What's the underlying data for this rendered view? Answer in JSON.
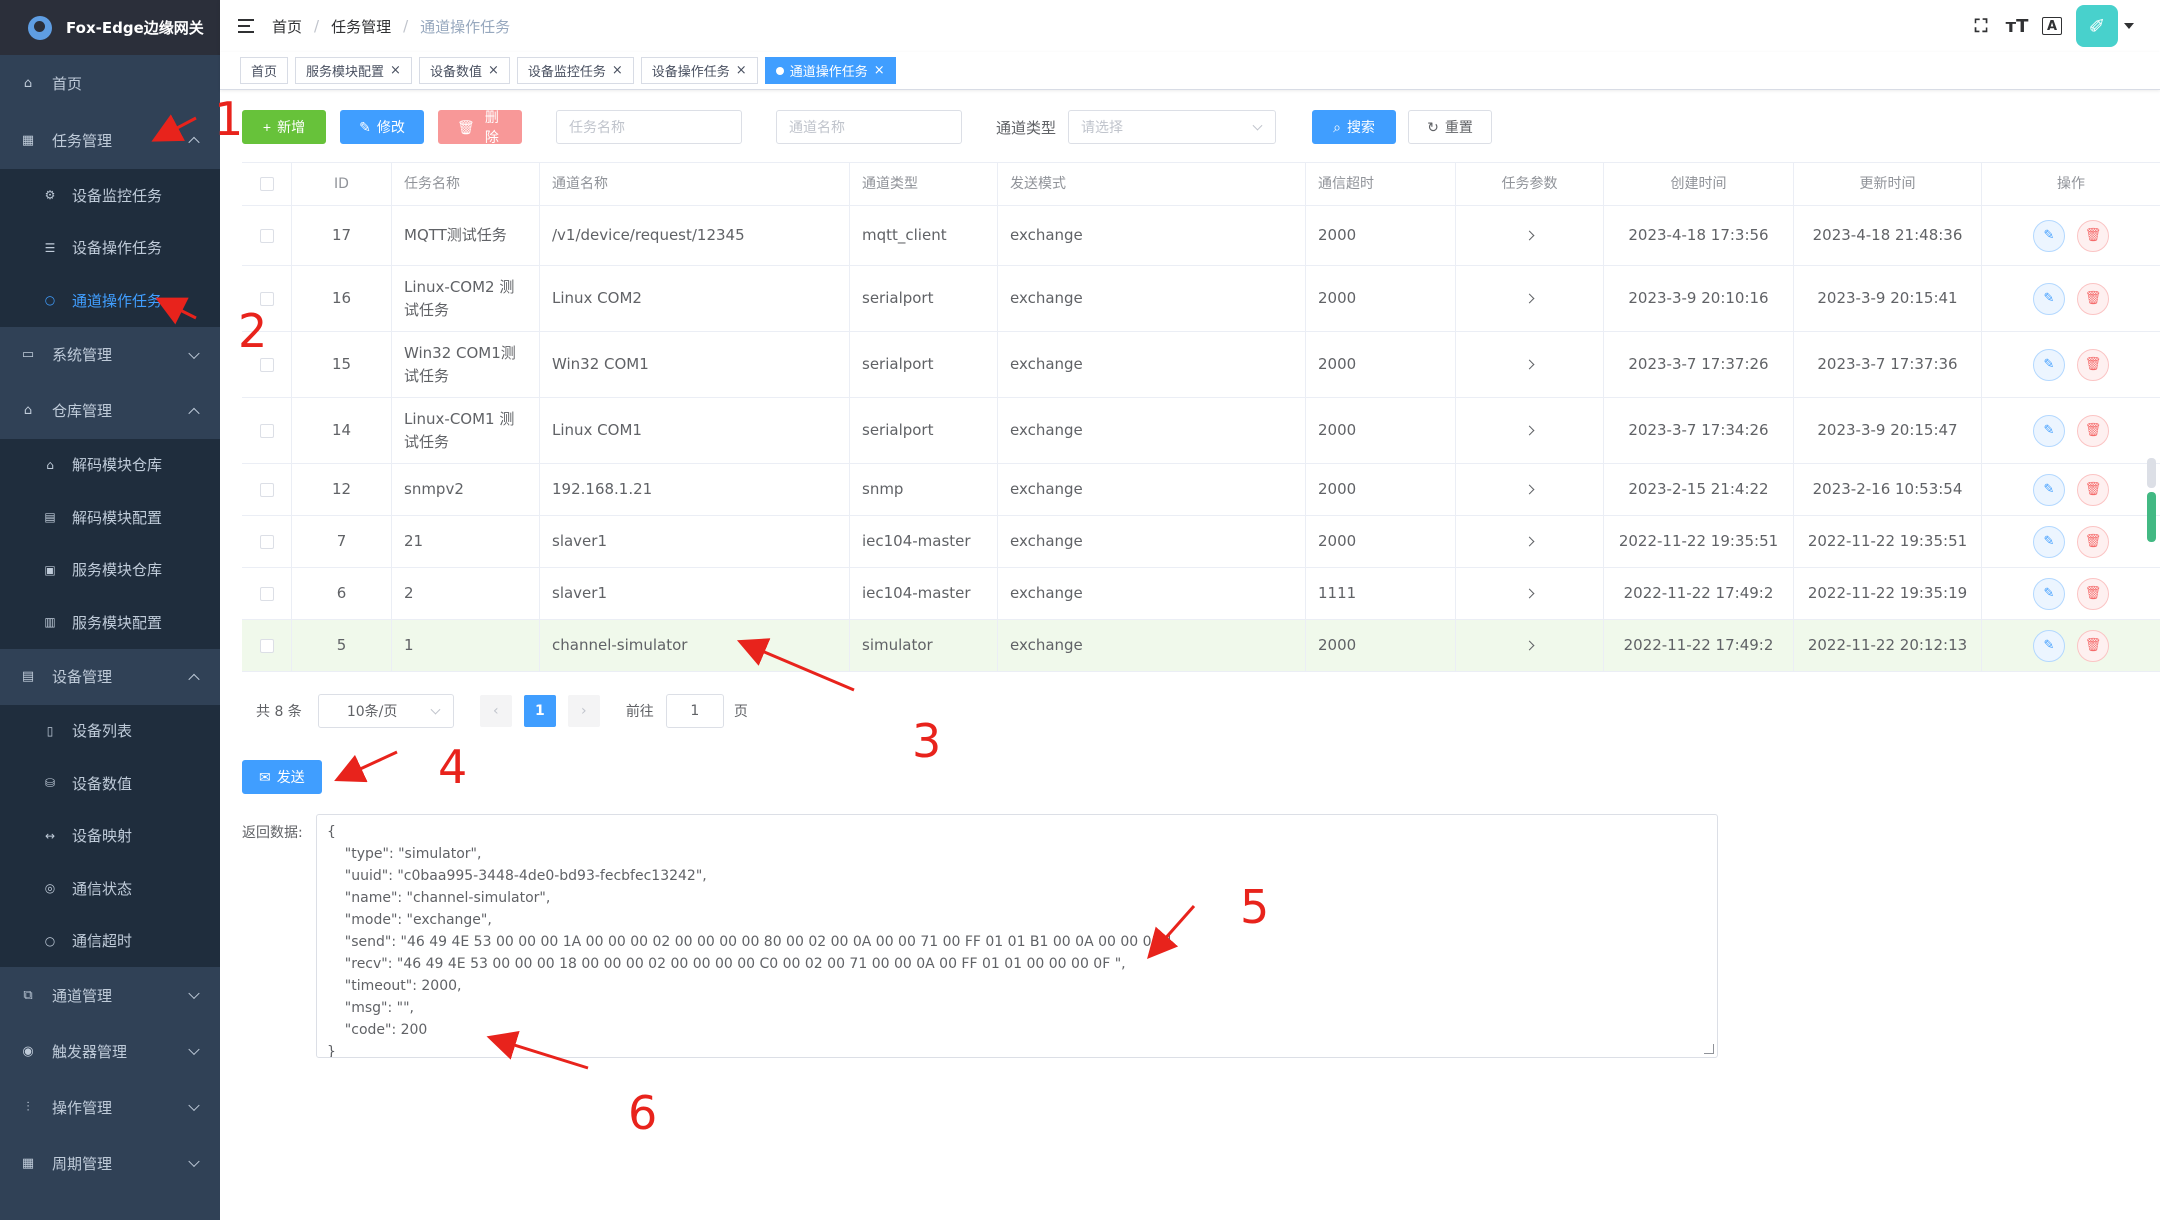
{
  "app": {
    "title": "Fox-Edge边缘网关"
  },
  "sidebar": {
    "home": "首页",
    "task_mgmt": "任务管理",
    "task_children": [
      "设备监控任务",
      "设备操作任务",
      "通道操作任务"
    ],
    "system_mgmt": "系统管理",
    "warehouse_mgmt": "仓库管理",
    "warehouse_children": [
      "解码模块仓库",
      "解码模块配置",
      "服务模块仓库",
      "服务模块配置"
    ],
    "device_mgmt": "设备管理",
    "device_children": [
      "设备列表",
      "设备数值",
      "设备映射",
      "通信状态",
      "通信超时"
    ],
    "channel_mgmt": "通道管理",
    "trigger_mgmt": "触发器管理",
    "operation_mgmt": "操作管理",
    "period_mgmt": "周期管理"
  },
  "breadcrumb": [
    "首页",
    "任务管理",
    "通道操作任务"
  ],
  "tags": [
    "首页",
    "服务模块配置",
    "设备数值",
    "设备监控任务",
    "设备操作任务",
    "通道操作任务"
  ],
  "toolbar": {
    "add": "新增",
    "edit": "修改",
    "delete": "删除",
    "task_name_placeholder": "任务名称",
    "channel_name_placeholder": "通道名称",
    "channel_type_label": "通道类型",
    "channel_type_placeholder": "请选择",
    "search": "搜索",
    "reset": "重置"
  },
  "table": {
    "headers": [
      "ID",
      "任务名称",
      "通道名称",
      "通道类型",
      "发送模式",
      "通信超时",
      "任务参数",
      "创建时间",
      "更新时间",
      "操作"
    ],
    "rows": [
      {
        "id": "17",
        "task": "MQTT测试任务",
        "channel": "/v1/device/request/12345",
        "type": "mqtt_client",
        "mode": "exchange",
        "timeout": "2000",
        "created": "2023-4-18 17:3:56",
        "updated": "2023-4-18 21:48:36"
      },
      {
        "id": "16",
        "task": "Linux-COM2 测试任务",
        "channel": "Linux COM2",
        "type": "serialport",
        "mode": "exchange",
        "timeout": "2000",
        "created": "2023-3-9 20:10:16",
        "updated": "2023-3-9 20:15:41"
      },
      {
        "id": "15",
        "task": "Win32 COM1测试任务",
        "channel": "Win32 COM1",
        "type": "serialport",
        "mode": "exchange",
        "timeout": "2000",
        "created": "2023-3-7 17:37:26",
        "updated": "2023-3-7 17:37:36"
      },
      {
        "id": "14",
        "task": "Linux-COM1 测试任务",
        "channel": "Linux COM1",
        "type": "serialport",
        "mode": "exchange",
        "timeout": "2000",
        "created": "2023-3-7 17:34:26",
        "updated": "2023-3-9 20:15:47"
      },
      {
        "id": "12",
        "task": "snmpv2",
        "channel": "192.168.1.21",
        "type": "snmp",
        "mode": "exchange",
        "timeout": "2000",
        "created": "2023-2-15 21:4:22",
        "updated": "2023-2-16 10:53:54"
      },
      {
        "id": "7",
        "task": "21",
        "channel": "slaver1",
        "type": "iec104-master",
        "mode": "exchange",
        "timeout": "2000",
        "created": "2022-11-22 19:35:51",
        "updated": "2022-11-22 19:35:51"
      },
      {
        "id": "6",
        "task": "2",
        "channel": "slaver1",
        "type": "iec104-master",
        "mode": "exchange",
        "timeout": "1111",
        "created": "2022-11-22 17:49:2",
        "updated": "2022-11-22 19:35:19"
      },
      {
        "id": "5",
        "task": "1",
        "channel": "channel-simulator",
        "type": "simulator",
        "mode": "exchange",
        "timeout": "2000",
        "created": "2022-11-22 17:49:2",
        "updated": "2022-11-22 20:12:13"
      }
    ]
  },
  "pagination": {
    "total": "共 8 条",
    "page_size": "10条/页",
    "current": "1",
    "goto_label": "前往",
    "goto_value": "1",
    "page_unit": "页"
  },
  "send_button": "发送",
  "return_label": "返回数据:",
  "return_data": "{\n    \"type\": \"simulator\",\n    \"uuid\": \"c0baa995-3448-4de0-bd93-fecbfec13242\",\n    \"name\": \"channel-simulator\",\n    \"mode\": \"exchange\",\n    \"send\": \"46 49 4E 53 00 00 00 1A 00 00 00 02 00 00 00 00 80 00 02 00 0A 00 00 71 00 FF 01 01 B1 00 0A 00 00 01 \",\n    \"recv\": \"46 49 4E 53 00 00 00 18 00 00 00 02 00 00 00 00 C0 00 02 00 71 00 00 0A 00 FF 01 01 00 00 00 0F \",\n    \"timeout\": 2000,\n    \"msg\": \"\",\n    \"code\": 200\n}",
  "annotations": [
    "1",
    "2",
    "3",
    "4",
    "5",
    "6"
  ],
  "colors": {
    "annotation": "#e8231c",
    "primary": "#409eff",
    "success": "#67c23a",
    "danger": "#f89898",
    "sidebar": "#304156"
  }
}
